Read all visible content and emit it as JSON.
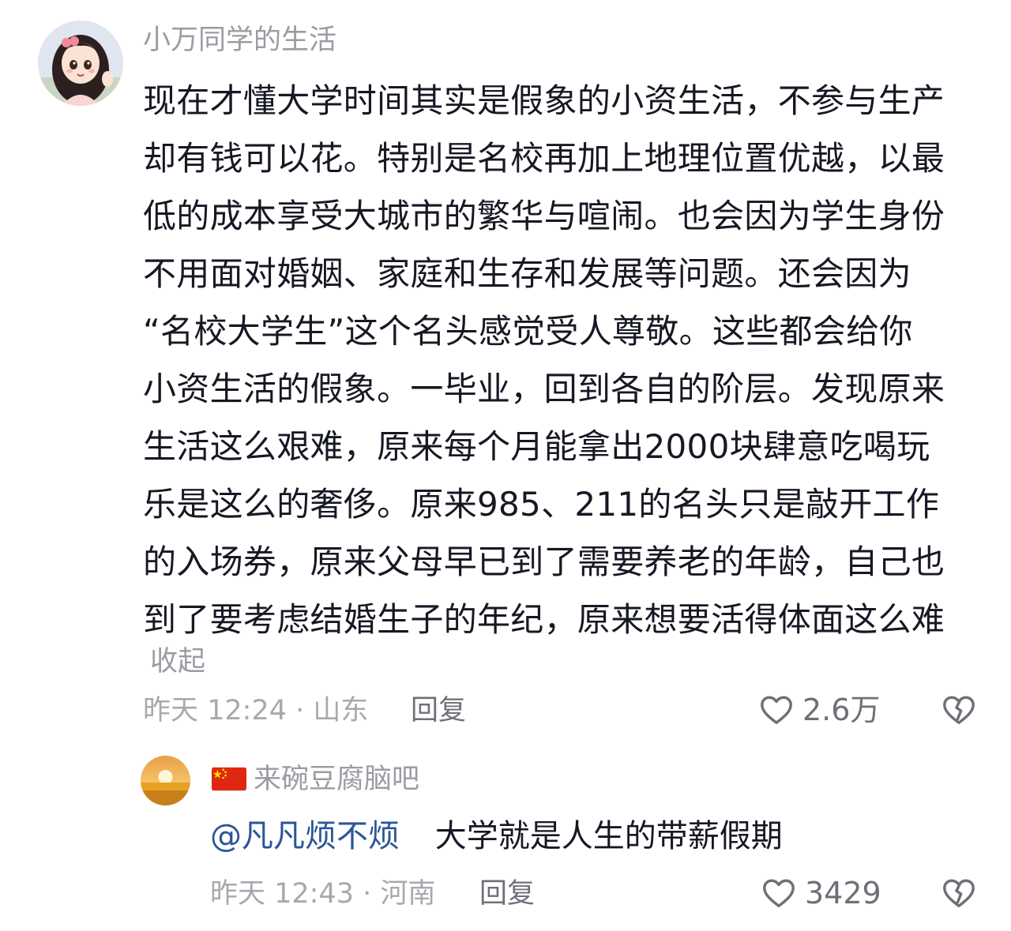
{
  "comment": {
    "username": "小万同学的生活",
    "lines": [
      "现在才懂大学时间其实是假象的小资生活，不参与生产",
      "却有钱可以花。特别是名校再加上地理位置优越，以最",
      "低的成本享受大城市的繁华与喧闹。也会因为学生身份",
      "不用面对婚姻、家庭和生存和发展等问题。还会因为",
      "“名校大学生”这个名头感觉受人尊敬。这些都会给你",
      "小资生活的假象。一毕业，回到各自的阶层。发现原来",
      "生活这么艰难，原来每个月能拿出2000块肆意吃喝玩",
      "乐是这么的奢侈。原来985、211的名头只是敲开工作",
      "的入场券，原来父母早已到了需要养老的年龄，自己也",
      "到了要考虑结婚生子的年纪，原来想要活得体面这么难"
    ],
    "collapse_label": "收起",
    "meta": "昨天 12:24 · 山东",
    "reply_label": "回复",
    "like_count": "2.6万"
  },
  "reply": {
    "username": "来碗豆腐脑吧",
    "flag_icon": "china-flag-icon",
    "mention": "@凡凡烦不烦",
    "text": "大学就是人生的带薪假期",
    "meta": "昨天 12:43 · 河南",
    "reply_label": "回复",
    "like_count": "3429"
  },
  "colors": {
    "text": "#161823",
    "secondary": "#9b9ca3",
    "mention": "#2c5598",
    "flag_red": "#de2910",
    "flag_star": "#ffde00"
  }
}
